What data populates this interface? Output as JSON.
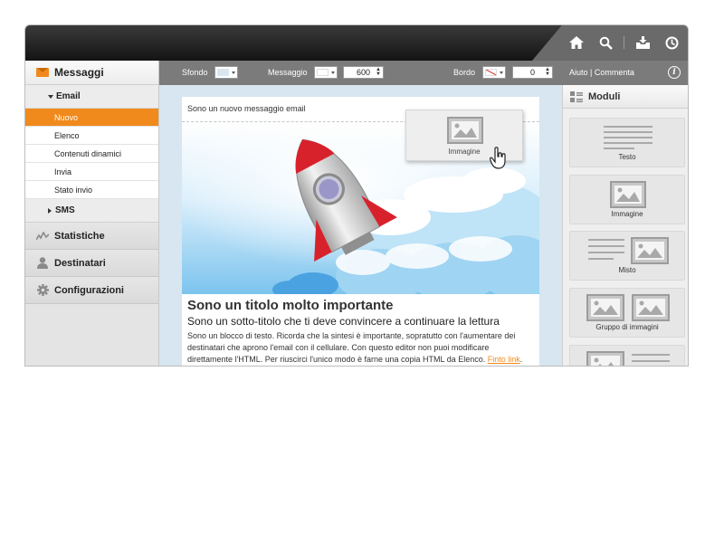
{
  "sidebar": {
    "header": "Messaggi",
    "email_group": "Email",
    "email_items": [
      "Nuovo",
      "Elenco",
      "Contenuti dinamici",
      "Invia",
      "Stato invio"
    ],
    "active_item": "Nuovo",
    "sms_group": "SMS",
    "sections": [
      "Statistiche",
      "Destinatari",
      "Configurazioni"
    ]
  },
  "toolbar": {
    "background_label": "Sfondo",
    "message_label": "Messaggio",
    "width_value": "600",
    "border_label": "Bordo",
    "border_value": "0",
    "help_link": "Aiuto | Commenta"
  },
  "editor": {
    "intro_text": "Sono un nuovo messaggio email",
    "drag_label": "Immagine",
    "title": "Sono un titolo molto importante",
    "subtitle": "Sono un sotto-titolo che ti deve convincere a continuare la lettura",
    "body": "Sono un blocco di testo. Ricorda che la sintesi è importante, sopratutto con l'aumentare dei destinatari che aprono l'email con il cellulare. Con questo editor non puoi modificare direttamente l'HTML. Per riuscirci l'unico modo è farne una copia HTML da Elenco.",
    "link_text": "Finto link"
  },
  "modules": {
    "header": "Moduli",
    "items": [
      "Testo",
      "Immagine",
      "Misto",
      "Gruppo di immagini"
    ]
  },
  "colors": {
    "accent": "#f08a1c",
    "toolbar": "#7b7b7b",
    "canvas": "#d7e6f0"
  },
  "icons": [
    "home-icon",
    "search-icon",
    "inbox-download-icon",
    "clock-icon",
    "mail-icon",
    "stats-icon",
    "user-icon",
    "gear-icon",
    "info-icon",
    "modules-icon",
    "image-icon",
    "hand-cursor-icon"
  ]
}
